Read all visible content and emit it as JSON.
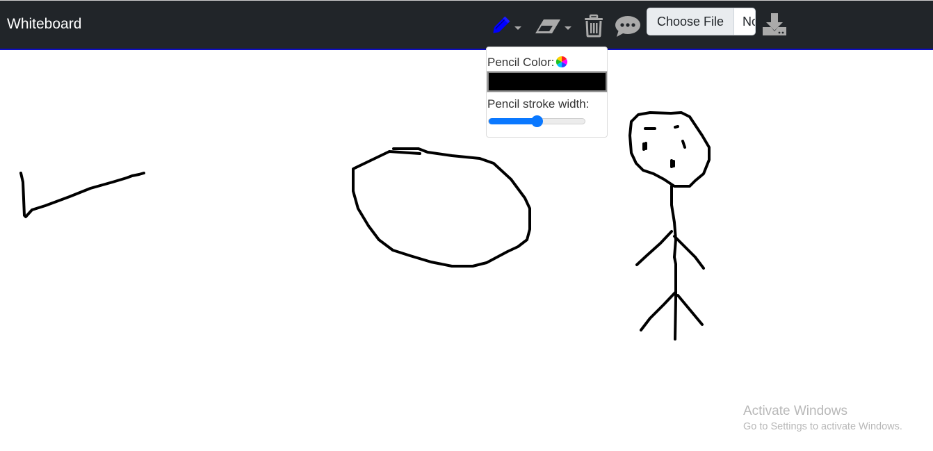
{
  "navbar": {
    "brand": "Whiteboard",
    "tools": [
      {
        "name": "pencil",
        "icon": "pencil-icon",
        "active": true,
        "color": "#0000ff",
        "has_dropdown": true
      },
      {
        "name": "eraser",
        "icon": "eraser-icon",
        "active": false,
        "color": "#aaaaaa",
        "has_dropdown": true
      },
      {
        "name": "clear",
        "icon": "trash-icon",
        "color": "#aaaaaa"
      },
      {
        "name": "chat",
        "icon": "speech-bubble-icon",
        "color": "#aaaaaa"
      },
      {
        "name": "download",
        "icon": "download-icon",
        "color": "#aaaaaa"
      }
    ],
    "file_input": {
      "button_label": "Choose File",
      "file_name": "No"
    }
  },
  "pencil_popover": {
    "color_label": "Pencil Color:",
    "color_icon": "color-wheel-icon",
    "color_value": "#000000",
    "stroke_label": "Pencil stroke width:",
    "stroke_value_fraction": 0.5
  },
  "canvas": {
    "stroke_color": "#000000",
    "strokes": [
      {
        "name": "check-stroke"
      },
      {
        "name": "oval-stroke"
      },
      {
        "name": "stick-figure-head"
      },
      {
        "name": "stick-figure-body"
      }
    ]
  },
  "watermark": {
    "title": "Activate Windows",
    "subtitle": "Go to Settings to activate Windows."
  }
}
